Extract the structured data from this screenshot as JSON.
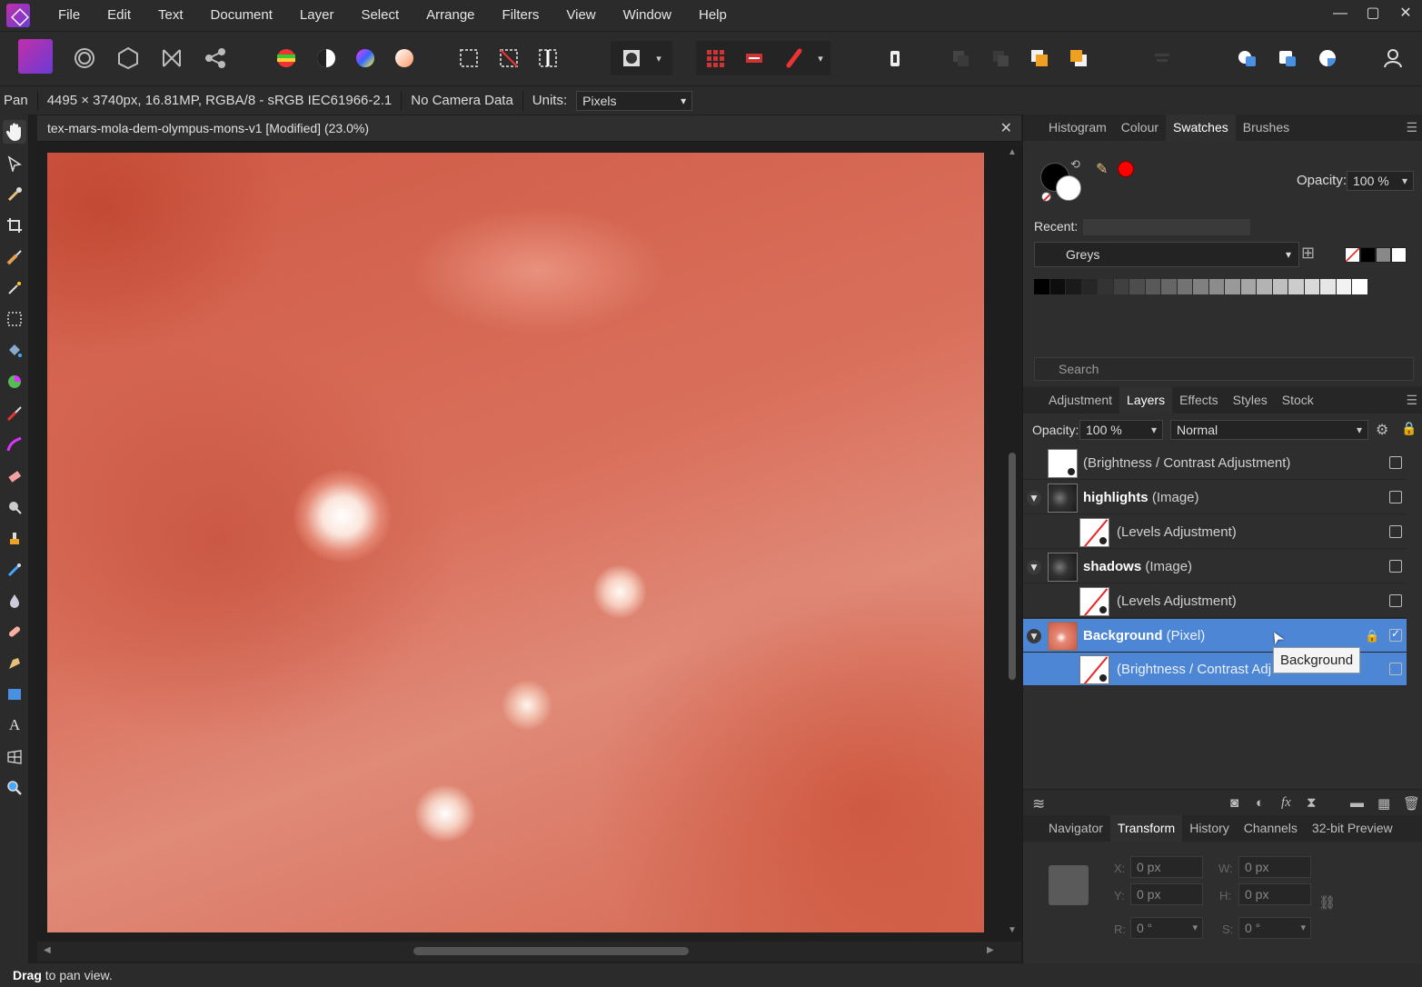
{
  "menu": [
    "File",
    "Edit",
    "Text",
    "Document",
    "Layer",
    "Select",
    "Arrange",
    "Filters",
    "View",
    "Window",
    "Help"
  ],
  "window_controls": [
    "—",
    "▢",
    "✕"
  ],
  "context": {
    "tool": "Pan",
    "info": "4495 × 3740px, 16.81MP, RGBA/8 - sRGB IEC61966-2.1",
    "camera": "No Camera Data",
    "units_label": "Units:",
    "units_value": "Pixels"
  },
  "document": {
    "title": "tex-mars-mola-dem-olympus-mons-v1 [Modified] (23.0%)",
    "close": "✕"
  },
  "top_panel": {
    "tabs": [
      "Histogram",
      "Colour",
      "Swatches",
      "Brushes"
    ],
    "active_tab": "Swatches",
    "opacity_label": "Opacity:",
    "opacity_value": "100 %",
    "recent_label": "Recent:",
    "palette": "Greys",
    "search_placeholder": "Search",
    "colors": {
      "foreground": "#000000",
      "background": "#ffffff",
      "picked": "#ff0000"
    }
  },
  "layers_panel": {
    "tabs": [
      "Adjustment",
      "Layers",
      "Effects",
      "Styles",
      "Stock"
    ],
    "active_tab": "Layers",
    "opacity_label": "Opacity:",
    "opacity_value": "100 %",
    "blend_mode": "Normal",
    "layers": [
      {
        "name": "",
        "type": "(Brightness / Contrast Adjustment)",
        "indent": 0,
        "checked": false
      },
      {
        "name": "highlights",
        "type": " (Image)",
        "indent": 0,
        "checked": false
      },
      {
        "name": "",
        "type": "(Levels Adjustment)",
        "indent": 1,
        "checked": false
      },
      {
        "name": "shadows",
        "type": " (Image)",
        "indent": 0,
        "checked": false
      },
      {
        "name": "",
        "type": "(Levels Adjustment)",
        "indent": 1,
        "checked": false
      },
      {
        "name": "Background",
        "type": " (Pixel)",
        "indent": 0,
        "checked": true
      },
      {
        "name": "",
        "type": "(Brightness / Contrast Adj",
        "indent": 1,
        "checked": false
      }
    ],
    "tooltip": "Background"
  },
  "bottom_panel": {
    "tabs": [
      "Navigator",
      "Transform",
      "History",
      "Channels",
      "32-bit Preview"
    ],
    "active_tab": "Transform",
    "x_label": "X:",
    "x_value": "0 px",
    "y_label": "Y:",
    "y_value": "0 px",
    "w_label": "W:",
    "w_value": "0 px",
    "h_label": "H:",
    "h_value": "0 px",
    "r_label": "R:",
    "r_value": "0 °",
    "s_label": "S:",
    "s_value": "0 °"
  },
  "status": {
    "bold": "Drag",
    "text": " to pan view."
  }
}
